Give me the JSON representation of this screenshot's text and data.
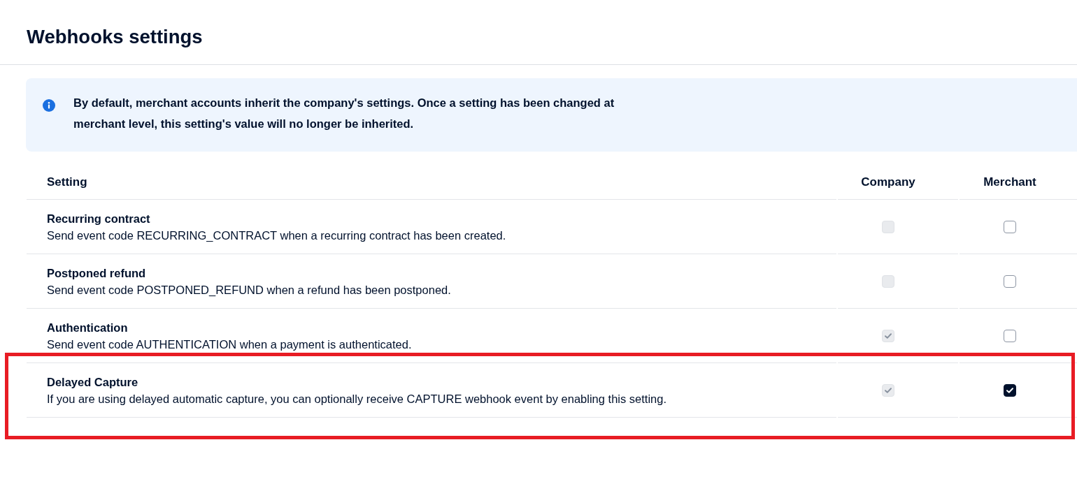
{
  "page": {
    "title": "Webhooks settings"
  },
  "info_banner": {
    "text": "By default, merchant accounts inherit the company's settings. Once a setting has been changed at merchant level, this setting's value will no longer be inherited."
  },
  "table": {
    "columns": [
      "Setting",
      "Company",
      "Merchant"
    ],
    "rows": [
      {
        "name": "Recurring contract",
        "description": "Send event code RECURRING_CONTRACT when a recurring contract has been created.",
        "company": {
          "checked": false,
          "disabled": true
        },
        "merchant": {
          "checked": false,
          "disabled": false
        },
        "highlighted": false
      },
      {
        "name": "Postponed refund",
        "description": "Send event code POSTPONED_REFUND when a refund has been postponed.",
        "company": {
          "checked": false,
          "disabled": true
        },
        "merchant": {
          "checked": false,
          "disabled": false
        },
        "highlighted": false
      },
      {
        "name": "Authentication",
        "description": "Send event code AUTHENTICATION when a payment is authenticated.",
        "company": {
          "checked": true,
          "disabled": true
        },
        "merchant": {
          "checked": false,
          "disabled": false
        },
        "highlighted": false
      },
      {
        "name": "Delayed Capture",
        "description": "If you are using delayed automatic capture, you can optionally receive CAPTURE webhook event by enabling this setting.",
        "company": {
          "checked": true,
          "disabled": true
        },
        "merchant": {
          "checked": true,
          "disabled": false
        },
        "highlighted": true
      }
    ]
  }
}
